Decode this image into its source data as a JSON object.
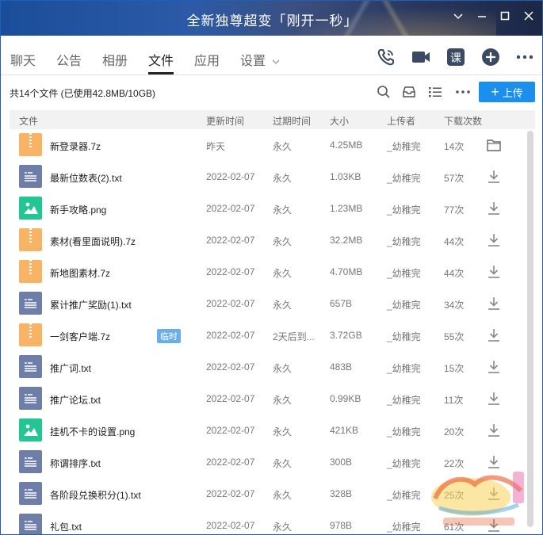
{
  "window": {
    "title": "全新独尊超变「刚开一秒」",
    "controls": [
      "chevron-down-icon",
      "minimize-icon",
      "maximize-icon",
      "close-icon"
    ]
  },
  "nav": {
    "tabs": [
      {
        "label": "聊天"
      },
      {
        "label": "公告"
      },
      {
        "label": "相册"
      },
      {
        "label": "文件",
        "active": true
      },
      {
        "label": "应用"
      },
      {
        "label": "设置"
      }
    ],
    "icons": [
      "phone-icon",
      "video-icon",
      "course-icon",
      "add-icon",
      "more-icon"
    ],
    "course_label": "课"
  },
  "toolbar": {
    "summary": "共14个文件 (已使用42.8MB/10GB)",
    "upload_label": "上传"
  },
  "table": {
    "headers": [
      "文件",
      "更新时间",
      "过期时间",
      "大小",
      "上传者",
      "下载次数"
    ],
    "rows": [
      {
        "type": "zip",
        "name": "新登录器.7z",
        "updated": "昨天",
        "expires": "永久",
        "size": "4.25MB",
        "uploader": "_幼稚完",
        "downloads": "14次",
        "action": "folder-icon"
      },
      {
        "type": "txt",
        "name": "最新位数表(2).txt",
        "updated": "2022-02-07",
        "expires": "永久",
        "size": "1.03KB",
        "uploader": "_幼稚完",
        "downloads": "57次",
        "action": "download-icon"
      },
      {
        "type": "png",
        "name": "新手攻略.png",
        "updated": "2022-02-07",
        "expires": "永久",
        "size": "1.23MB",
        "uploader": "_幼稚完",
        "downloads": "77次",
        "action": "download-icon"
      },
      {
        "type": "zip",
        "name": "素材(看里面说明).7z",
        "updated": "2022-02-07",
        "expires": "永久",
        "size": "32.2MB",
        "uploader": "_幼稚完",
        "downloads": "44次",
        "action": "download-icon"
      },
      {
        "type": "zip",
        "name": "新地图素材.7z",
        "updated": "2022-02-07",
        "expires": "永久",
        "size": "4.70MB",
        "uploader": "_幼稚完",
        "downloads": "44次",
        "action": "download-icon"
      },
      {
        "type": "txt",
        "name": "累计推广奖励(1).txt",
        "updated": "2022-02-07",
        "expires": "永久",
        "size": "657B",
        "uploader": "_幼稚完",
        "downloads": "34次",
        "action": "download-icon"
      },
      {
        "type": "zip",
        "name": "一剑客户端.7z",
        "badge": "临时",
        "updated": "2022-02-07",
        "expires": "2天后到...",
        "size": "3.72GB",
        "uploader": "_幼稚完",
        "downloads": "55次",
        "action": "download-icon"
      },
      {
        "type": "txt",
        "name": "推广词.txt",
        "updated": "2022-02-07",
        "expires": "永久",
        "size": "483B",
        "uploader": "_幼稚完",
        "downloads": "15次",
        "action": "download-icon"
      },
      {
        "type": "txt",
        "name": "推广论坛.txt",
        "updated": "2022-02-07",
        "expires": "永久",
        "size": "0.99KB",
        "uploader": "_幼稚完",
        "downloads": "11次",
        "action": "download-icon"
      },
      {
        "type": "png",
        "name": "挂机不卡的设置.png",
        "updated": "2022-02-07",
        "expires": "永久",
        "size": "421KB",
        "uploader": "_幼稚完",
        "downloads": "20次",
        "action": "download-icon"
      },
      {
        "type": "txt",
        "name": "称谓排序.txt",
        "updated": "2022-02-07",
        "expires": "永久",
        "size": "300B",
        "uploader": "_幼稚完",
        "downloads": "22次",
        "action": "download-icon"
      },
      {
        "type": "txt",
        "name": "各阶段兑换积分(1).txt",
        "updated": "2022-02-07",
        "expires": "永久",
        "size": "328B",
        "uploader": "_幼稚完",
        "downloads": "25次",
        "action": "download-icon"
      },
      {
        "type": "txt",
        "name": "礼包.txt",
        "updated": "2022-02-07",
        "expires": "永久",
        "size": "978B",
        "uploader": "_幼稚完",
        "downloads": "61次",
        "action": "download-icon"
      }
    ]
  },
  "colors": {
    "accent": "#1a8fee",
    "zip": "#f8b465",
    "txt": "#6e7ea6",
    "png": "#22c593",
    "badge": "#6aaee8"
  },
  "watermark": "watermark-logo"
}
